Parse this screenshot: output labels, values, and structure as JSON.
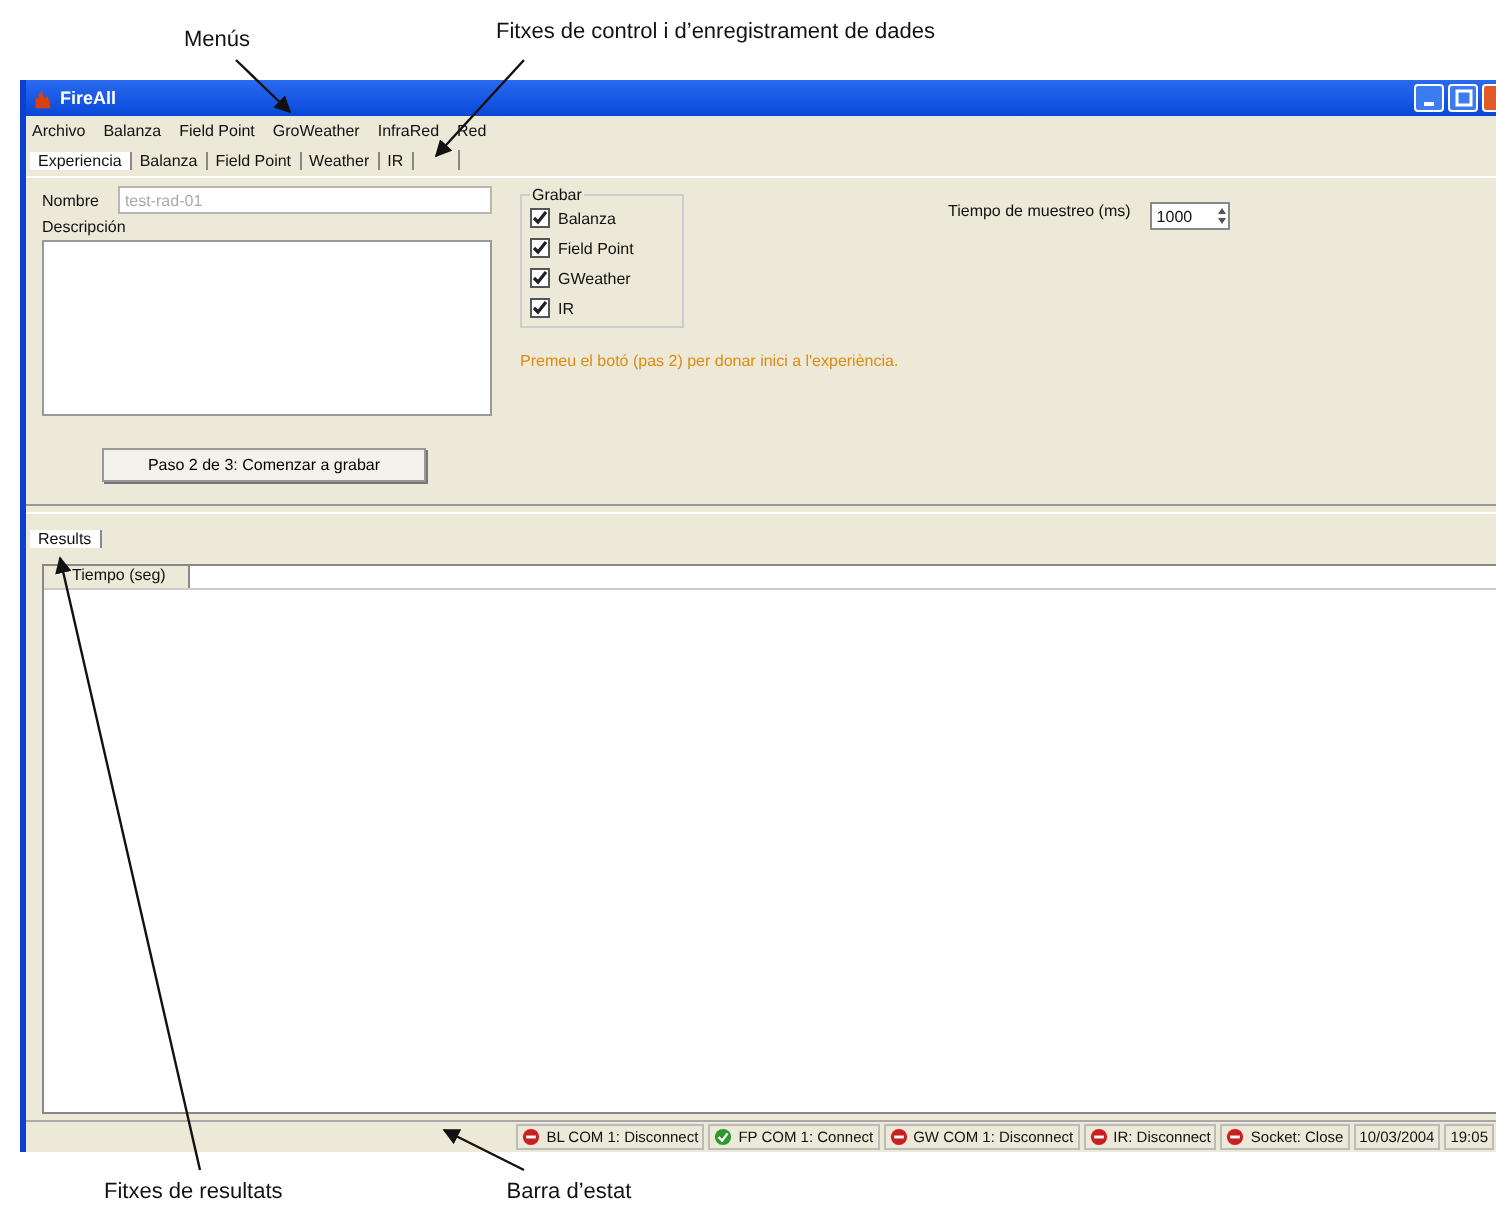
{
  "annotations": [
    {
      "text": "Menús"
    },
    {
      "text": "Fitxes de control i d’enregistrament de dades"
    },
    {
      "text": "Fitxes de resultats"
    },
    {
      "text": "Barra d’estat"
    }
  ],
  "window": {
    "title": "FireAll"
  },
  "menu": [
    "Archivo",
    "Balanza",
    "Field Point",
    "GroWeather",
    "InfraRed",
    "Red"
  ],
  "tabs": [
    {
      "label": "Experiencia",
      "selected": true
    },
    {
      "label": "Balanza",
      "selected": false
    },
    {
      "label": "Field Point",
      "selected": false
    },
    {
      "label": "Weather",
      "selected": false
    },
    {
      "label": "IR",
      "selected": false
    }
  ],
  "form": {
    "name_label": "Nombre",
    "name_value": "test-rad-01",
    "description_label": "Descripción",
    "record_group": "Grabar",
    "record_items": [
      {
        "label": "Balanza",
        "checked": true
      },
      {
        "label": "Field Point",
        "checked": true
      },
      {
        "label": "GWeather",
        "checked": true
      },
      {
        "label": "IR",
        "checked": true
      }
    ],
    "sample_label": "Tiempo de muestreo (ms)",
    "sample_value": "1000",
    "hint": "Premeu el botó (pas 2) per donar inici a l'experiència.",
    "start_button": "Paso 2 de 3: Comenzar a grabar"
  },
  "results_tabs": [
    {
      "label": "Results",
      "selected": true
    }
  ],
  "table": {
    "columns": [
      "Tiempo (seg)"
    ]
  },
  "status_bar": [
    {
      "text": "BL COM 1: Disconnect",
      "connected": false
    },
    {
      "text": "FP COM 1: Connect",
      "connected": true
    },
    {
      "text": "GW COM 1: Disconnect",
      "connected": false
    },
    {
      "text": "IR: Disconnect",
      "connected": false
    },
    {
      "text": "Socket: Close",
      "connected": false
    }
  ],
  "status_date": "10/03/2004",
  "status_time": "19:05"
}
